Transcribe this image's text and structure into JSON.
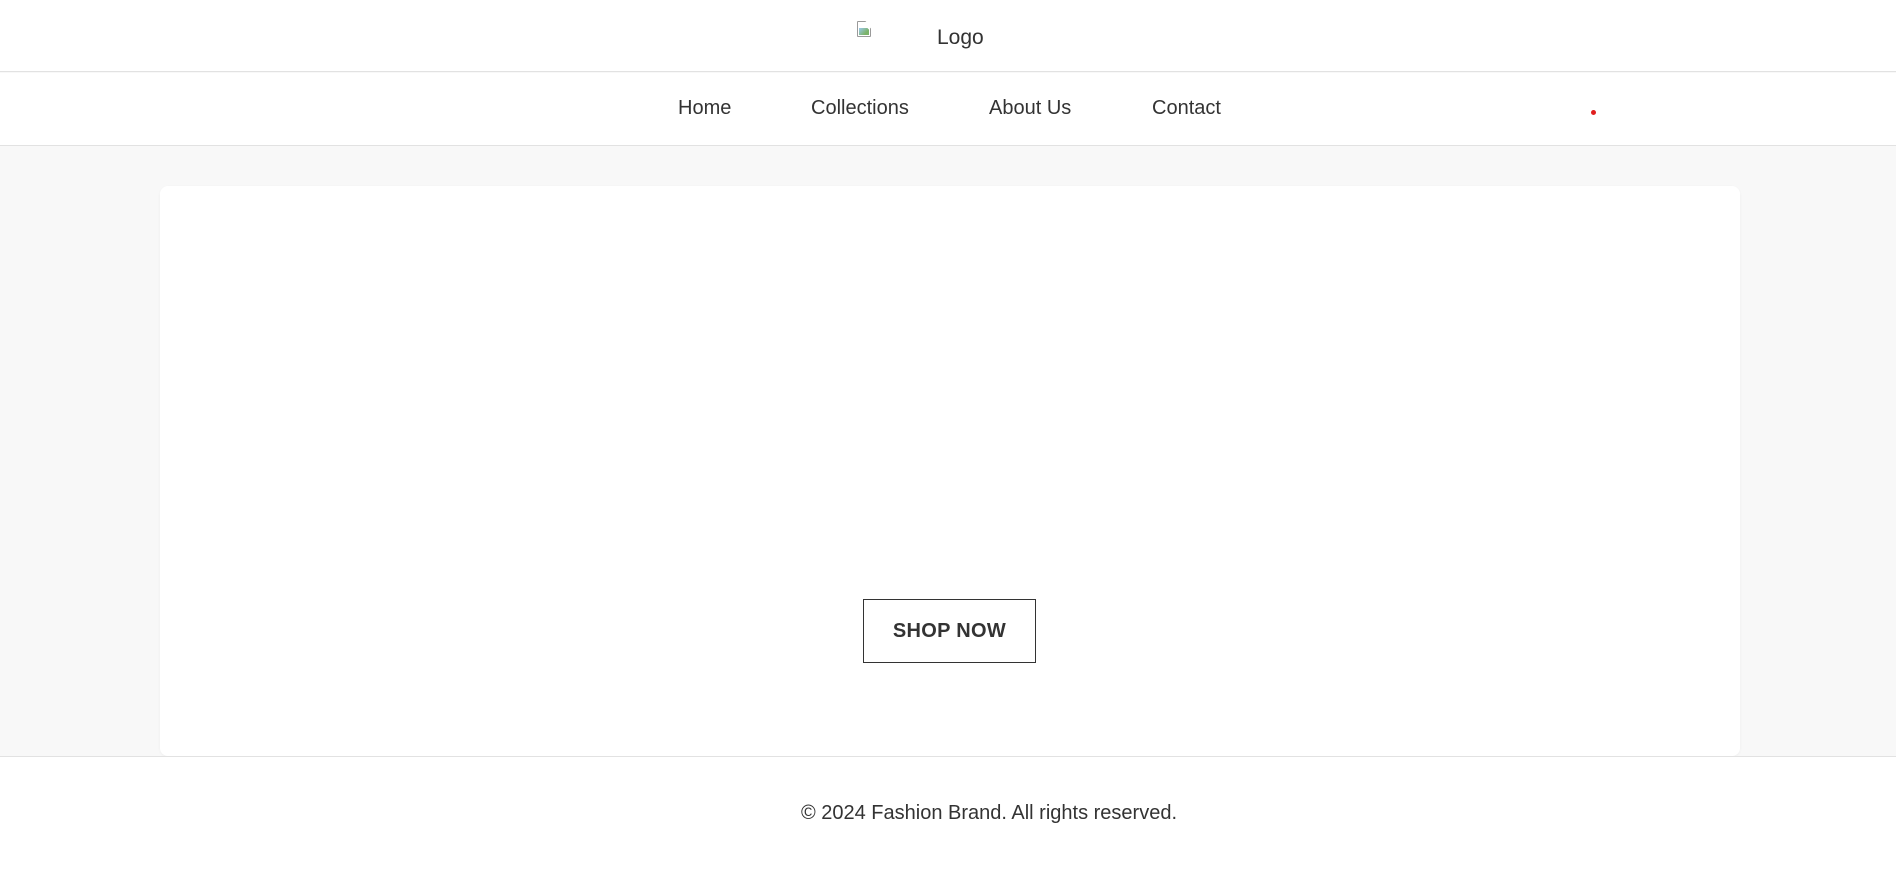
{
  "header": {
    "logo_alt": "Logo",
    "logo_icon": "broken-image-icon"
  },
  "nav": {
    "items": [
      {
        "label": "Home"
      },
      {
        "label": "Collections"
      },
      {
        "label": "About Us"
      },
      {
        "label": "Contact"
      }
    ],
    "cart_indicator_color": "#e01e1e"
  },
  "hero": {
    "button_label": "SHOP NOW"
  },
  "footer": {
    "copyright": "© 2024 Fashion Brand. All rights reserved."
  },
  "colors": {
    "text": "#333333",
    "background": "#f8f8f8",
    "surface": "#ffffff",
    "border": "#e2e2e2",
    "accent": "#e01e1e"
  }
}
